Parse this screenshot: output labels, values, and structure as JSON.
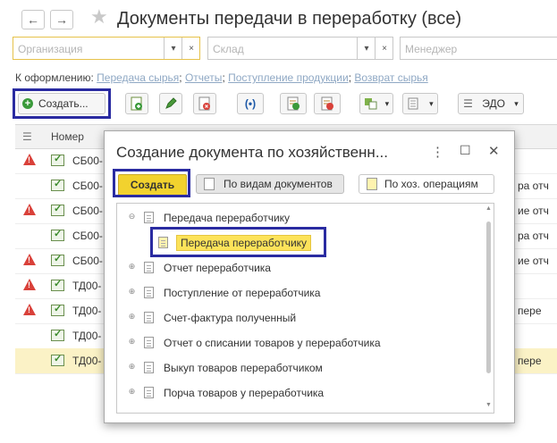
{
  "window": {
    "title": "Документы передачи в переработку (все)",
    "nav": {
      "back_icon": "←",
      "forward_icon": "→",
      "star_icon": "★"
    }
  },
  "filters": {
    "organization_placeholder": "Организация",
    "warehouse_placeholder": "Склад",
    "manager_placeholder": "Менеджер",
    "dropdown_icon": "▾",
    "clear_icon": "×"
  },
  "links": {
    "prefix": "К оформлению:",
    "items": [
      "Передача сырья",
      "Отчеты",
      "Поступление продукции",
      "Возврат сырья"
    ],
    "separator": ";"
  },
  "toolbar": {
    "create_label": "Создать...",
    "edo_label": "ЭДО",
    "dropdown_icon": "▾"
  },
  "table": {
    "column_number": "Номер",
    "rows": [
      {
        "warn": true,
        "number": "СБ00-",
        "right": ""
      },
      {
        "warn": false,
        "number": "СБ00-",
        "right": "ра отч"
      },
      {
        "warn": true,
        "number": "СБ00-",
        "right": "ие отч"
      },
      {
        "warn": false,
        "number": "СБ00-",
        "right": "ра отч"
      },
      {
        "warn": true,
        "number": "СБ00-",
        "right": "ие отч"
      },
      {
        "warn": true,
        "number": "ТД00-",
        "right": ""
      },
      {
        "warn": true,
        "number": "ТД00-",
        "right": "пере"
      },
      {
        "warn": false,
        "number": "ТД00-",
        "right": ""
      },
      {
        "warn": false,
        "number": "ТД00-",
        "right": "пере",
        "selected": true
      }
    ]
  },
  "dialog": {
    "title": "Создание документа по хозяйственн...",
    "more_icon": "⋮",
    "maximize_icon": "☐",
    "close_icon": "✕",
    "create_label": "Создать",
    "tab_by_doc_types": "По видам документов",
    "tab_by_operations": "По хоз. операциям",
    "tree": {
      "group_label": "Передача переработчику",
      "selected_child": "Передача переработчику",
      "items": [
        "Отчет переработчика",
        "Поступление от переработчика",
        "Счет-фактура полученный",
        "Отчет о списании товаров у переработчика",
        "Выкуп товаров переработчиком",
        "Порча товаров у переработчика"
      ],
      "collapse_symbol": "⊖",
      "expand_symbol": "⊕"
    }
  },
  "colors": {
    "highlight_border": "#2a2ba1",
    "create_button": "#f2d22e",
    "selected_row": "#fbf2c6",
    "selected_item": "#fde35a",
    "warning": "#d9413a",
    "link": "#8fa8c4"
  }
}
